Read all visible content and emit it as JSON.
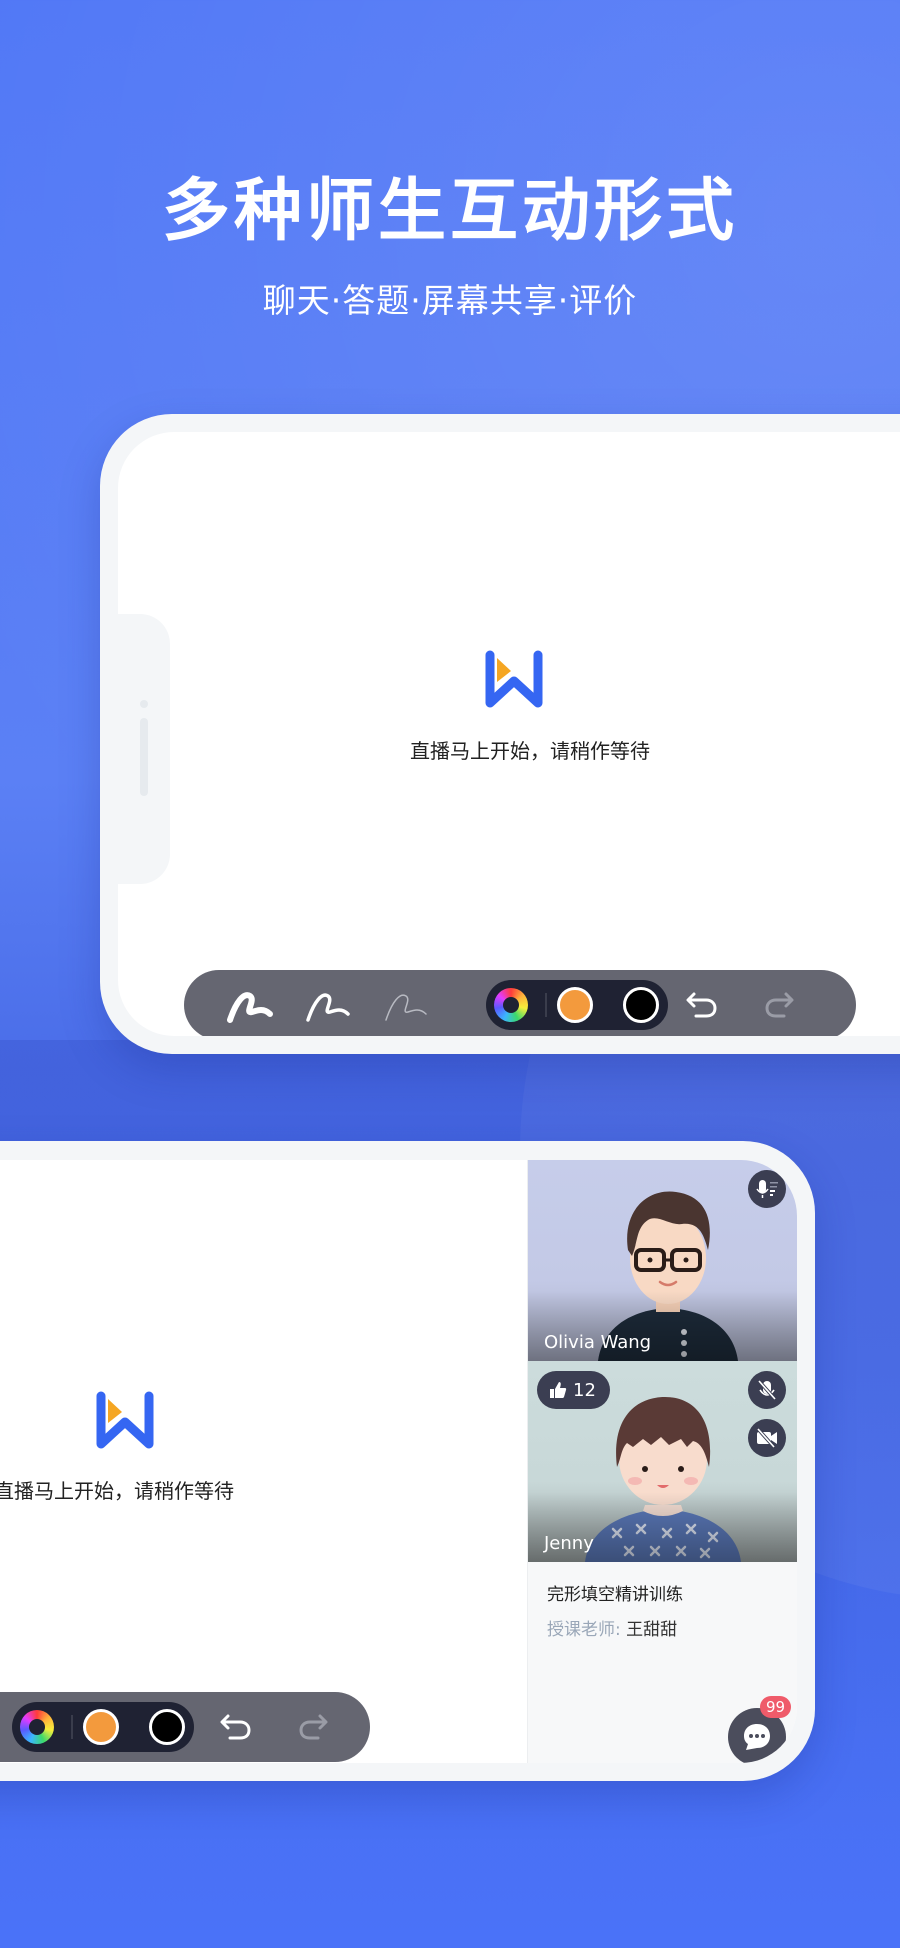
{
  "header": {
    "title": "多种师生互动形式",
    "subtitle": "聊天·答题·屏幕共享·评价"
  },
  "colors": {
    "background": "#5077f6",
    "toolbar": "#656671",
    "palette_bg": "#1f2233",
    "swatch_orange": "#f39a3d",
    "swatch_black": "#000000",
    "logo_blue": "#3566f2",
    "logo_orange": "#f5a623",
    "badge": "#ef5b6a"
  },
  "phone1": {
    "waiting_text": "直播马上开始，请稍作等待",
    "toolbar": {
      "pens": [
        "pen-thick",
        "pen-medium",
        "pen-thin"
      ],
      "colors": [
        "color-wheel",
        "orange",
        "black"
      ],
      "undo": "undo-icon",
      "redo": "redo-icon"
    }
  },
  "phone2": {
    "waiting_text": "直播马上开始，请稍作等待",
    "videos": [
      {
        "name": "Olivia Wang",
        "status_icon": "mic-speaking-icon"
      },
      {
        "name": "Jenny",
        "likes": "12",
        "status_icons": [
          "mic-muted-icon",
          "camera-off-icon"
        ]
      }
    ],
    "course": {
      "title": "完形填空精讲训练",
      "teacher_label": "授课老师:",
      "teacher_name": "王甜甜"
    },
    "chat": {
      "badge": "99"
    }
  }
}
